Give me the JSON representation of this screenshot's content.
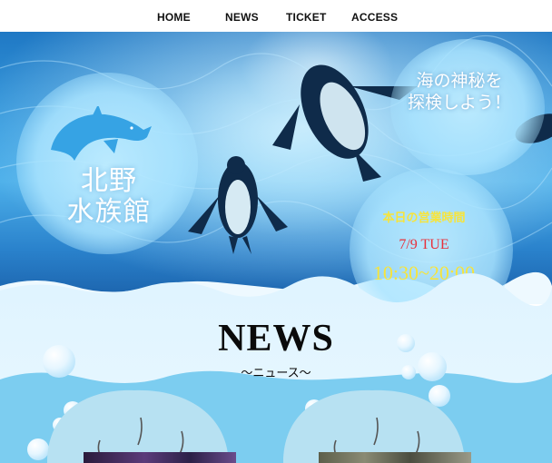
{
  "nav": {
    "items": [
      {
        "label": "HOME"
      },
      {
        "label": "NEWS"
      },
      {
        "label": "TICKET"
      },
      {
        "label": "ACCESS"
      }
    ]
  },
  "hero": {
    "title_line1": "北野",
    "title_line2": "水族館",
    "tagline_line1": "海の神秘を",
    "tagline_line2": "探検しよう！",
    "hours_label": "本日の営業時間",
    "hours_date": "7/9 TUE",
    "hours_time": "10:30~20:00",
    "logo_icon": "dolphin-icon"
  },
  "news": {
    "title": "NEWS",
    "subtitle": "〜ニュース〜"
  },
  "colors": {
    "accent_yellow": "#f7e43b",
    "accent_red": "#e8303a",
    "water_blue": "#3a9ee0",
    "section_blue": "#7ccdf0"
  }
}
